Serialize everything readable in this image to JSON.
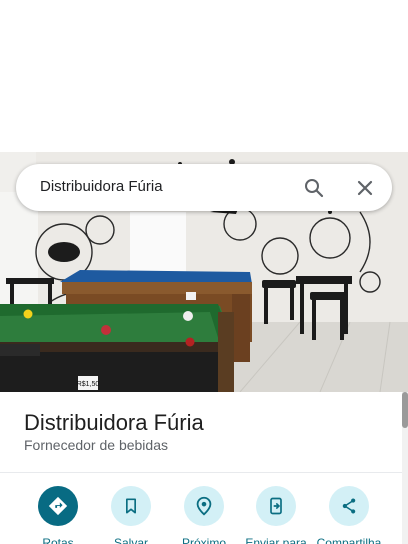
{
  "search": {
    "query": "Distribuidora Fúria"
  },
  "place": {
    "name": "Distribuidora Fúria",
    "category": "Fornecedor de bebidas",
    "photo": {
      "price_tag": "R$1,50"
    }
  },
  "actions": [
    {
      "label": "Rotas",
      "icon": "directions-icon"
    },
    {
      "label": "Salvar",
      "icon": "bookmark-icon"
    },
    {
      "label": "Próximo",
      "icon": "nearby-icon"
    },
    {
      "label": "Enviar para",
      "icon": "send-to-phone-icon"
    },
    {
      "label": "Compartilha",
      "icon": "share-icon"
    }
  ],
  "colors": {
    "accent": "#086b83",
    "action_bg": "#d3f0f6",
    "label": "#0b6e82"
  }
}
